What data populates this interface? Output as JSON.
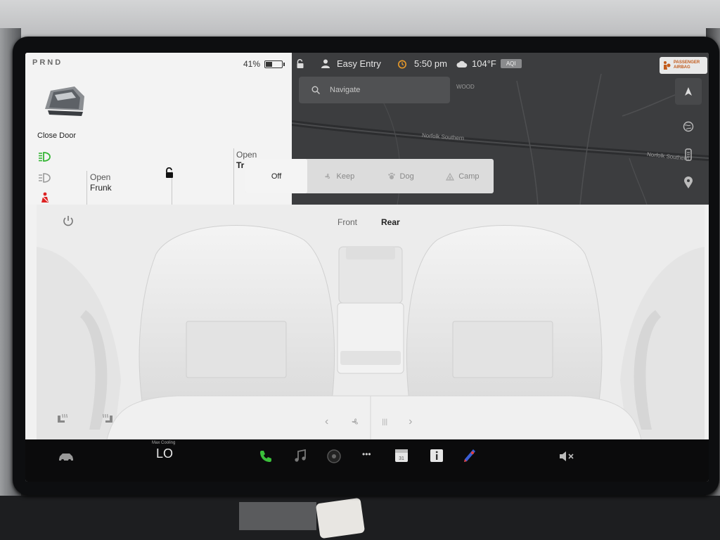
{
  "header": {
    "gear": "PRND",
    "battery_percent": "41%",
    "battery_level": 0.41
  },
  "car_controls": {
    "close_door": "Close Door",
    "open_frunk_label": "Open",
    "open_frunk_value": "Frunk",
    "open_trunk_label": "Open",
    "open_trunk_value": "Tr"
  },
  "status": {
    "profile": "Easy Entry",
    "time": "5:50 pm",
    "temperature": "104°F",
    "aqi": "AQI",
    "airbag_line1": "PASSENGER",
    "airbag_line2": "AIRBAG"
  },
  "map": {
    "search_placeholder": "Navigate",
    "road_1": "Norfolk Southern",
    "road_2": "WOOD",
    "road_3": "Norfolk Southern"
  },
  "climate_modes": {
    "items": [
      "Off",
      "Keep",
      "Dog",
      "Camp"
    ],
    "active": "Off"
  },
  "seat_view": {
    "front": "Front",
    "rear": "Rear",
    "active": "Rear"
  },
  "dock": {
    "max_cooling": "Max Cooling",
    "temp": "LO",
    "more": "•••"
  },
  "colors": {
    "phone_green": "#3bbf3b",
    "headlight_green": "#33b533",
    "seatbelt_red": "#d22",
    "airbag_orange": "#c25b1c"
  }
}
